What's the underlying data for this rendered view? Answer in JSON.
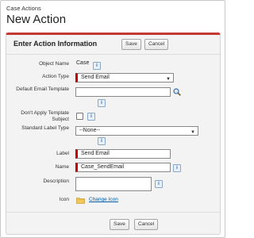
{
  "header": {
    "breadcrumb": "Case Actions",
    "title": "New Action"
  },
  "section": {
    "title": "Enter Action Information",
    "save_label": "Save",
    "cancel_label": "Cancel"
  },
  "form": {
    "object_name": {
      "label": "Object Name",
      "value": "Case"
    },
    "action_type": {
      "label": "Action Type",
      "value": "Send Email"
    },
    "default_email_template": {
      "label": "Default Email Template",
      "value": ""
    },
    "dont_apply_template_subject": {
      "label": "Don't Apply Template Subject",
      "checked": false
    },
    "standard_label_type": {
      "label": "Standard Label Type",
      "value": "--None--"
    },
    "label": {
      "label": "Label",
      "value": "Send Email"
    },
    "name": {
      "label": "Name",
      "value": "Case_SendEmail"
    },
    "description": {
      "label": "Description",
      "value": ""
    },
    "icon": {
      "label": "Icon",
      "link": "Change Icon"
    }
  },
  "footer": {
    "save_label": "Save",
    "cancel_label": "Cancel"
  },
  "icons": {
    "info": "info-icon",
    "lookup": "magnifier-lookup-icon",
    "folder": "folder-icon",
    "dropdown": "chevron-down-icon"
  },
  "colors": {
    "required": "#c00000",
    "accent": "#c23934",
    "link": "#015ba7"
  }
}
